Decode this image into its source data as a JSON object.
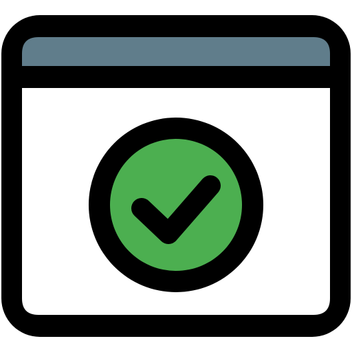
{
  "icon": {
    "name": "browser-window-check-icon",
    "colors": {
      "outline": "#000000",
      "titlebar": "#607d8b",
      "window_body": "#ffffff",
      "check_circle": "#4caf50",
      "checkmark": "#000000"
    }
  }
}
